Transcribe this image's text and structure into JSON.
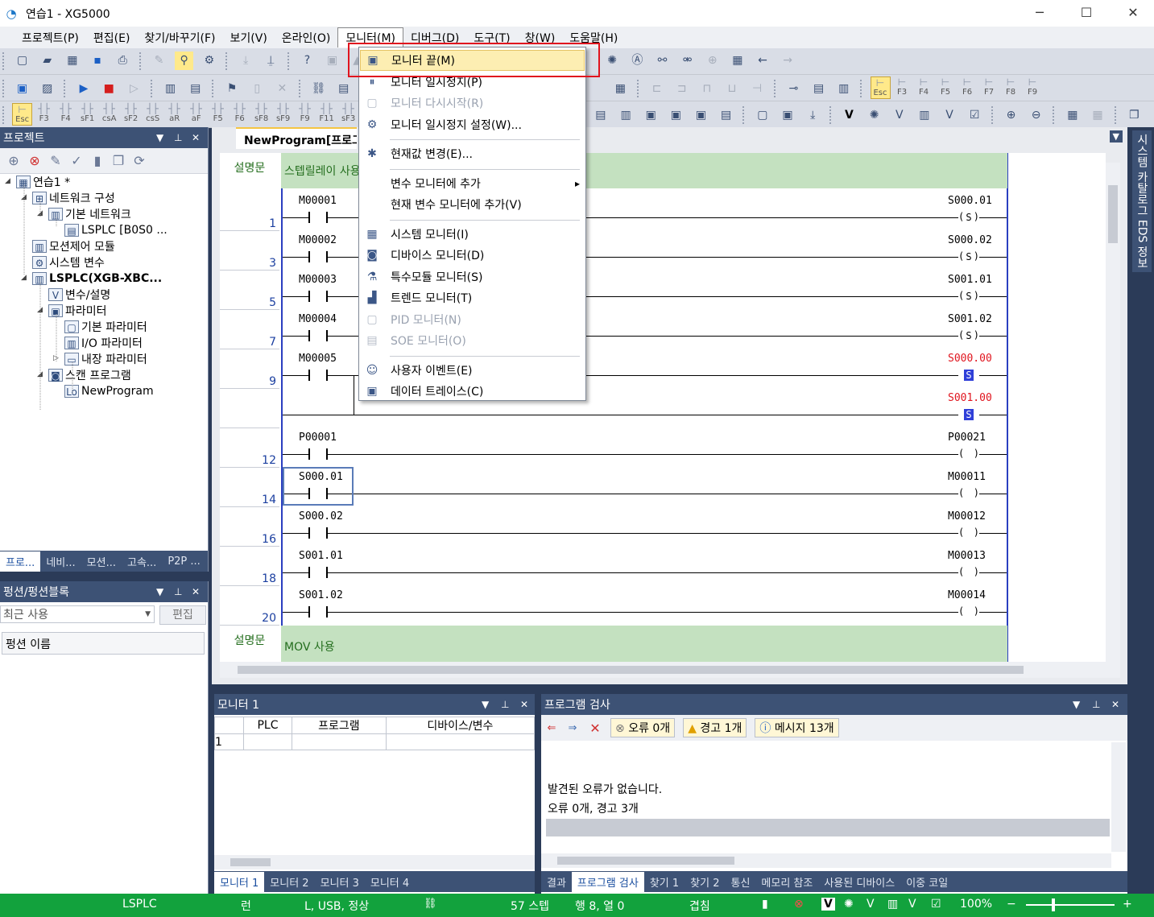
{
  "window": {
    "title": "연습1 - XG5000",
    "minimize": "─",
    "maximize": "☐",
    "close": "✕"
  },
  "menu": [
    "프로젝트(P)",
    "편집(E)",
    "찾기/바꾸기(F)",
    "보기(V)",
    "온라인(O)",
    "모니터(M)",
    "디버그(D)",
    "도구(T)",
    "창(W)",
    "도움말(H)"
  ],
  "menu_active": 5,
  "fkeys": [
    [
      "Esc",
      "Esc"
    ],
    [
      "F3",
      ""
    ],
    [
      "F4",
      ""
    ],
    [
      "sF1",
      ""
    ],
    [
      "csA",
      ""
    ],
    [
      "sF2",
      ""
    ],
    [
      "csS",
      ""
    ],
    [
      "aR",
      ""
    ],
    [
      "aF",
      ""
    ],
    [
      "F5",
      ""
    ],
    [
      "F6",
      ""
    ],
    [
      "sF8",
      ""
    ],
    [
      "sF9",
      ""
    ],
    [
      "F9",
      ""
    ],
    [
      "F11",
      ""
    ],
    [
      "sF3",
      ""
    ]
  ],
  "fkeys2": [
    "Esc",
    "F3",
    "F4",
    "F5",
    "F6",
    "F7",
    "F8",
    "F9"
  ],
  "project": {
    "title": "프로젝트",
    "tree": [
      {
        "label": "연습1 *",
        "level": 0,
        "icon": "project-icon",
        "glyph": "▦",
        "bold": false,
        "expander": "◢"
      },
      {
        "label": "네트워크 구성",
        "level": 1,
        "icon": "network-icon",
        "glyph": "⊞",
        "expander": "◢"
      },
      {
        "label": "기본 네트워크",
        "level": 2,
        "icon": "basic-network-icon",
        "glyph": "▥",
        "expander": "◢"
      },
      {
        "label": "LSPLC [B0S0 ...",
        "level": 3,
        "icon": "plc-node-icon",
        "glyph": "▤",
        "expander": ""
      },
      {
        "label": "모션제어 모듈",
        "level": 1,
        "icon": "motion-module-icon",
        "glyph": "▥",
        "expander": ""
      },
      {
        "label": "시스템 변수",
        "level": 1,
        "icon": "system-variable-icon",
        "glyph": "⚙",
        "expander": ""
      },
      {
        "label": "LSPLC(XGB-XBC...",
        "level": 1,
        "icon": "plc-icon",
        "glyph": "▥",
        "bold": true,
        "expander": "◢"
      },
      {
        "label": "변수/설명",
        "level": 2,
        "icon": "variable-icon",
        "glyph": "V",
        "expander": ""
      },
      {
        "label": "파라미터",
        "level": 2,
        "icon": "parameter-icon",
        "glyph": "▣",
        "expander": "◢"
      },
      {
        "label": "기본 파라미터",
        "level": 3,
        "icon": "basic-parameter-icon",
        "glyph": "▢",
        "expander": ""
      },
      {
        "label": "I/O 파라미터",
        "level": 3,
        "icon": "io-parameter-icon",
        "glyph": "▥",
        "expander": ""
      },
      {
        "label": "내장 파라미터",
        "level": 3,
        "icon": "builtin-parameter-icon",
        "glyph": "▭",
        "expander": "▷"
      },
      {
        "label": "스캔 프로그램",
        "level": 2,
        "icon": "scan-program-icon",
        "glyph": "◙",
        "expander": "◢"
      },
      {
        "label": "NewProgram",
        "level": 3,
        "icon": "program-icon",
        "glyph": "Lo",
        "expander": ""
      }
    ],
    "tabs": [
      "프로...",
      "네비...",
      "모션...",
      "고속...",
      "P2P ..."
    ]
  },
  "function": {
    "title": "펑션/펑션블록",
    "combo": "최근 사용",
    "edit": "편집",
    "header": "펑션 이름"
  },
  "editor": {
    "tab": "NewProgram[프로그램]",
    "comments": [
      {
        "label": "설명문",
        "text": "스텝릴레이 사용"
      },
      {
        "label": "설명문",
        "text": "MOV 사용"
      }
    ],
    "rungs": [
      {
        "num": "1",
        "contact": "M00001",
        "coil": "S000.01",
        "coil_type": "S",
        "active": false
      },
      {
        "num": "3",
        "contact": "M00002",
        "coil": "S000.02",
        "coil_type": "S",
        "active": false
      },
      {
        "num": "5",
        "contact": "M00003",
        "coil": "S001.01",
        "coil_type": "S",
        "active": false
      },
      {
        "num": "7",
        "contact": "M00004",
        "coil": "S001.02",
        "coil_type": "S",
        "active": false
      },
      {
        "num": "9",
        "contact": "M00005",
        "coil": "S000.00",
        "coil_type": "S",
        "active": true
      },
      {
        "num": "",
        "contact": "",
        "coil": "S001.00",
        "coil_type": "S",
        "active": true
      },
      {
        "num": "12",
        "contact": "P00001",
        "coil": "P00021",
        "coil_type": " ",
        "active": false
      },
      {
        "num": "14",
        "contact": "S000.01",
        "coil": "M00011",
        "coil_type": " ",
        "active": false
      },
      {
        "num": "16",
        "contact": "S000.02",
        "coil": "M00012",
        "coil_type": " ",
        "active": false
      },
      {
        "num": "18",
        "contact": "S001.01",
        "coil": "M00013",
        "coil_type": " ",
        "active": false
      },
      {
        "num": "20",
        "contact": "S001.02",
        "coil": "M00014",
        "coil_type": " ",
        "active": false
      }
    ]
  },
  "dropdown": [
    {
      "label": "모니터 끝(M)",
      "icon": "monitor-stop-icon",
      "glyph": "▣",
      "state": "hl"
    },
    {
      "label": "모니터 일시정지(P)",
      "icon": "monitor-pause-icon",
      "glyph": "⏸",
      "state": ""
    },
    {
      "label": "모니터 다시시작(R)",
      "icon": "monitor-restart-icon",
      "glyph": "▢",
      "state": "dis"
    },
    {
      "label": "모니터 일시정지 설정(W)...",
      "icon": "pause-setting-icon",
      "glyph": "⚙",
      "state": ""
    },
    {
      "sep": true
    },
    {
      "label": "현재값 변경(E)...",
      "icon": "change-value-icon",
      "glyph": "✱",
      "state": ""
    },
    {
      "sep": true
    },
    {
      "label": "변수 모니터에 추가",
      "icon": "",
      "glyph": "",
      "state": "",
      "arrow": "▸"
    },
    {
      "label": "현재 변수 모니터에 추가(V)",
      "icon": "",
      "glyph": "",
      "state": ""
    },
    {
      "sep": true
    },
    {
      "label": "시스템 모니터(I)",
      "icon": "system-monitor-icon",
      "glyph": "▦",
      "state": ""
    },
    {
      "label": "디바이스 모니터(D)",
      "icon": "device-monitor-icon",
      "glyph": "◙",
      "state": ""
    },
    {
      "label": "특수모듈 모니터(S)",
      "icon": "special-module-icon",
      "glyph": "⚗",
      "state": ""
    },
    {
      "label": "트렌드 모니터(T)",
      "icon": "trend-monitor-icon",
      "glyph": "▟",
      "state": ""
    },
    {
      "label": "PID 모니터(N)",
      "icon": "pid-monitor-icon",
      "glyph": "▢",
      "state": "dis"
    },
    {
      "label": "SOE 모니터(O)",
      "icon": "soe-monitor-icon",
      "glyph": "▤",
      "state": "dis"
    },
    {
      "sep": true
    },
    {
      "label": "사용자 이벤트(E)",
      "icon": "user-event-icon",
      "glyph": "☺",
      "state": ""
    },
    {
      "label": "데이터 트레이스(C)",
      "icon": "data-trace-icon",
      "glyph": "▣",
      "state": ""
    }
  ],
  "monitor": {
    "title": "모니터 1",
    "columns": [
      "PLC",
      "프로그램",
      "디바이스/변수"
    ],
    "rows": [
      "1"
    ],
    "tabs": [
      "모니터 1",
      "모니터 2",
      "모니터 3",
      "모니터 4"
    ]
  },
  "check": {
    "title": "프로그램 검사",
    "error": "오류 0개",
    "warning": "경고 1개",
    "message": "메시지 13개",
    "lines": [
      "발견된 오류가 없습니다.",
      "오류 0개, 경고 3개"
    ],
    "tabs": [
      "결과",
      "프로그램 검사",
      "찾기 1",
      "찾기 2",
      "통신",
      "메모리 참조",
      "사용된 디바이스",
      "이중 코일"
    ]
  },
  "right_tab": "시스템 카탈로그  EDS 정보",
  "status": {
    "plc": "LSPLC",
    "mode": "런",
    "conn": "L, USB, 정상",
    "steps": "57 스텝",
    "pos": "행 8, 열 0",
    "overwrite": "겹침",
    "zoom": "100%"
  },
  "colors": {
    "accent": "#3d5275",
    "status": "#12a23d",
    "highlight": "#fdeeb2",
    "redbox": "#e0141e",
    "active_coil": "#e0141e"
  }
}
